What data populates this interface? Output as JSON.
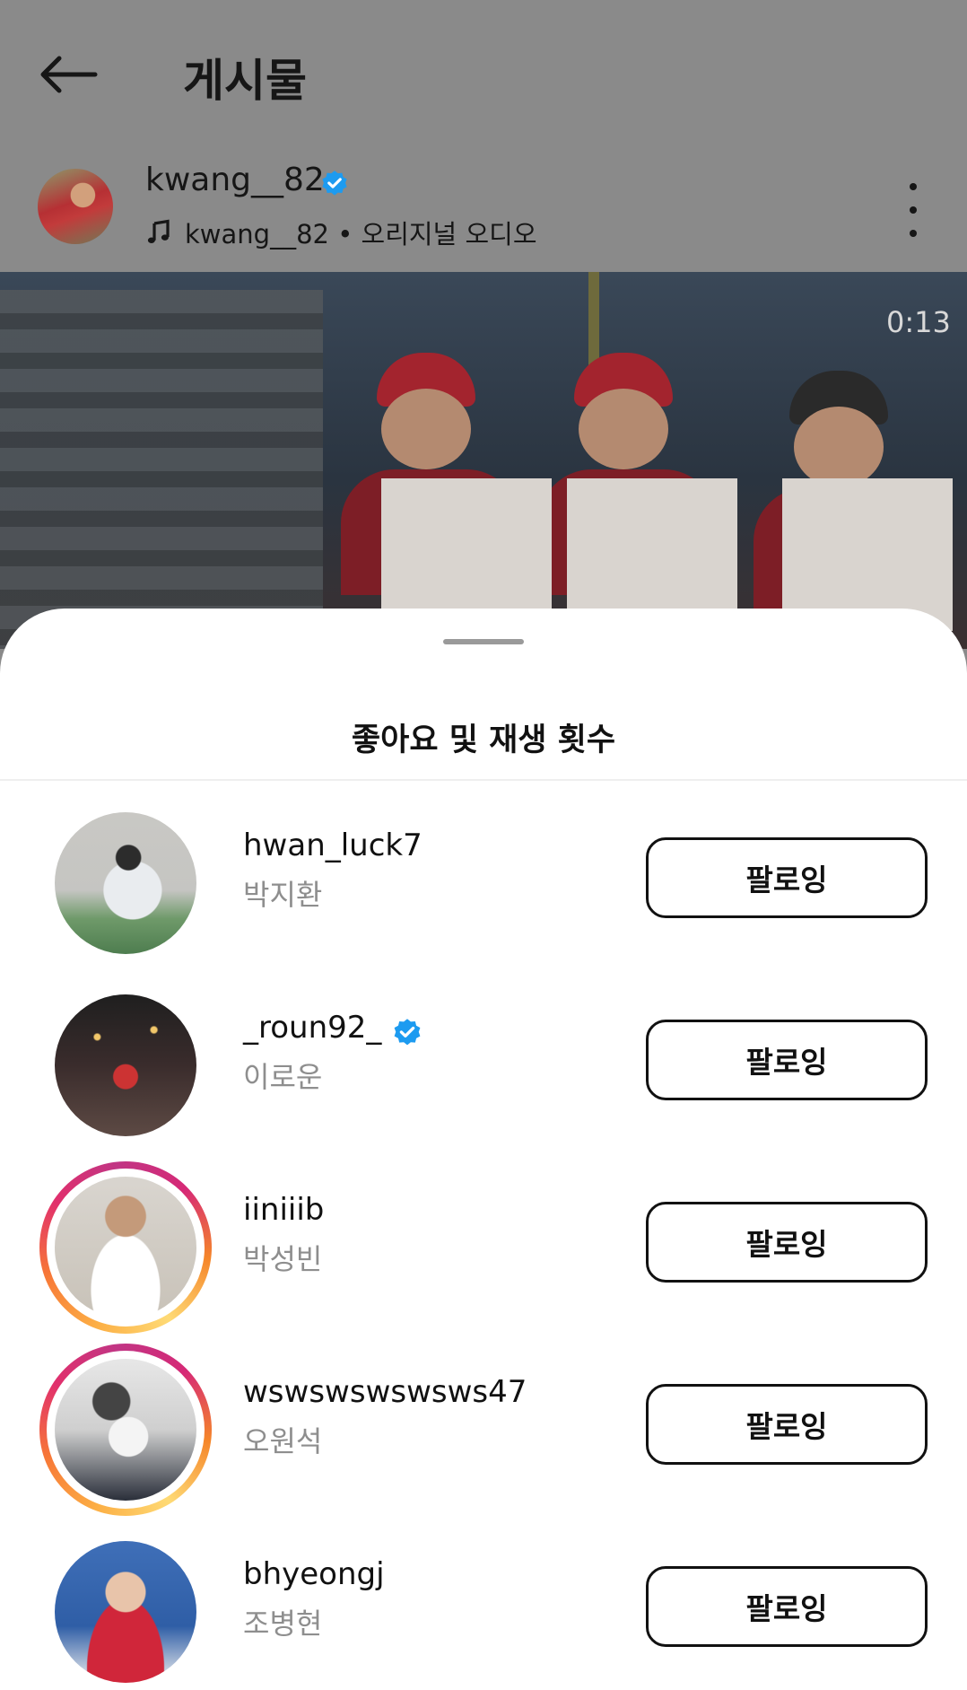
{
  "header": {
    "title": "게시물",
    "back_icon": "arrow-left-icon"
  },
  "post": {
    "author": "kwang__82",
    "verified": true,
    "audio_label": "kwang__82 • 오리지널 오디오",
    "video_time": "0:13",
    "more_icon": "more-vertical-icon"
  },
  "likes_sheet": {
    "title": "좋아요 및 재생 횟수",
    "users": [
      {
        "username": "hwan_luck7",
        "full_name": "박지환",
        "verified": false,
        "story_ring": false,
        "button_label": "팔로잉"
      },
      {
        "username": "_roun92_",
        "full_name": "이로운",
        "verified": true,
        "story_ring": false,
        "button_label": "팔로잉"
      },
      {
        "username": "iiniiib",
        "full_name": "박성빈",
        "verified": false,
        "story_ring": true,
        "button_label": "팔로잉"
      },
      {
        "username": "wswswswswsws47",
        "full_name": "오원석",
        "verified": false,
        "story_ring": true,
        "button_label": "팔로잉"
      },
      {
        "username": "bhyeongj",
        "full_name": "조병현",
        "verified": false,
        "story_ring": false,
        "button_label": "팔로잉"
      }
    ]
  },
  "colors": {
    "verified_blue": "#1d9bf0",
    "dim_overlay": "#8a8a8a",
    "follow_border": "#111111",
    "secondary_text": "#8e8e8e"
  }
}
